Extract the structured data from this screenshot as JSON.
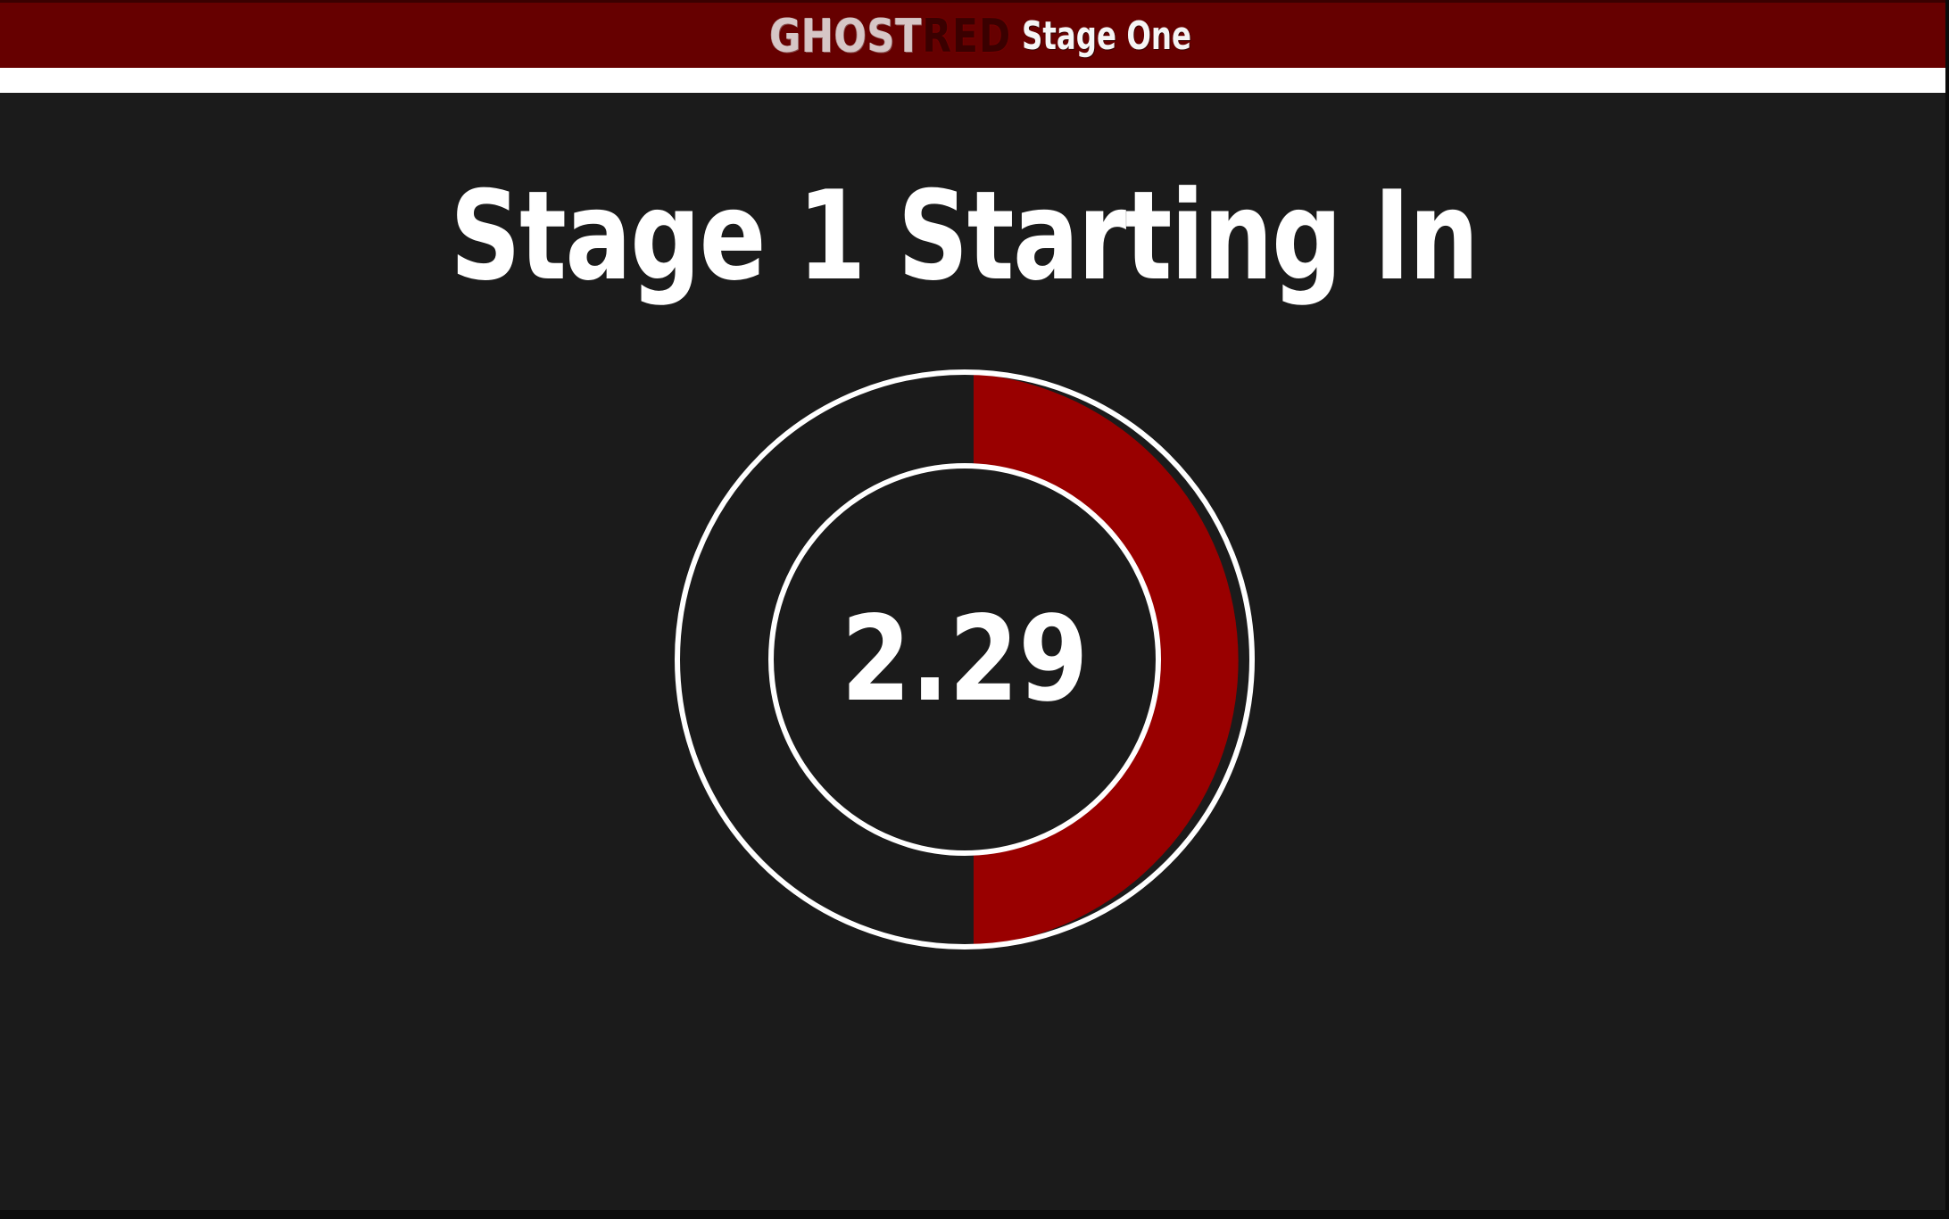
{
  "header": {
    "logo_part1": "GHOST",
    "logo_part2": "RED",
    "stage_name": "Stage One"
  },
  "main": {
    "heading": "Stage 1 Starting In",
    "timer_value": "2.29",
    "timer_progress_fraction": 0.5
  },
  "colors": {
    "accent_red": "#990000",
    "topbar": "#660000",
    "background": "#1b1b1b",
    "ring": "#ffffff"
  }
}
